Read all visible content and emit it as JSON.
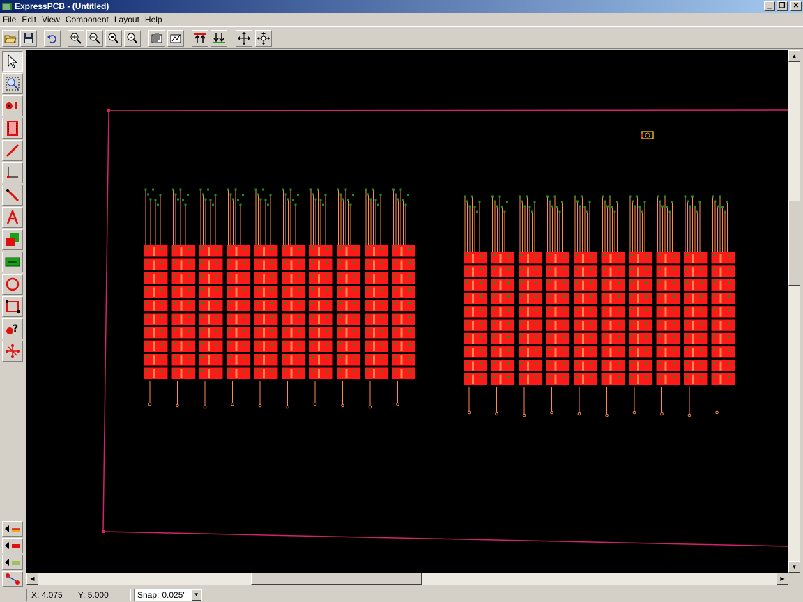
{
  "window": {
    "title": "ExpressPCB - (Untitled)"
  },
  "menu": [
    "File",
    "Edit",
    "View",
    "Component",
    "Layout",
    "Help"
  ],
  "toolbar": [
    {
      "name": "open-icon"
    },
    {
      "name": "save-icon"
    },
    {
      "name": "undo-icon"
    },
    {
      "name": "zoom-in-icon"
    },
    {
      "name": "zoom-out-icon"
    },
    {
      "name": "zoom-fit-icon"
    },
    {
      "name": "zoom-previous-icon"
    },
    {
      "name": "component-properties-icon"
    },
    {
      "name": "pad-properties-icon"
    },
    {
      "name": "top-layer-icon"
    },
    {
      "name": "bottom-layer-icon"
    },
    {
      "name": "move-icon"
    },
    {
      "name": "move-all-icon"
    }
  ],
  "left_tools": [
    {
      "name": "select-tool-icon"
    },
    {
      "name": "zoom-select-tool-icon"
    },
    {
      "name": "pad-tool-icon"
    },
    {
      "name": "component-tool-icon"
    },
    {
      "name": "trace-tool-icon"
    },
    {
      "name": "corner-trace-tool-icon"
    },
    {
      "name": "line-tool-icon"
    },
    {
      "name": "text-tool-icon"
    },
    {
      "name": "fill-tool-icon"
    },
    {
      "name": "ground-plane-tool-icon"
    },
    {
      "name": "circle-tool-icon"
    },
    {
      "name": "rectangle-tool-icon"
    },
    {
      "name": "query-tool-icon"
    },
    {
      "name": "netlist-tool-icon"
    }
  ],
  "layer_tools": [
    {
      "name": "top-layer-select-icon"
    },
    {
      "name": "bottom-layer-select-icon"
    },
    {
      "name": "silkscreen-layer-select-icon"
    },
    {
      "name": "ratsnest-tool-icon"
    }
  ],
  "colors": {
    "board_outline": "#d4226b",
    "pads": "#ff1a1a",
    "traces": "#ff8a4a",
    "vias": "#1a8f1a",
    "canvas": "#000000"
  },
  "status": {
    "x_label": "X: 4.075",
    "y_label": "Y: 5.000",
    "snap_label": "Snap:",
    "snap_value": "0.025\""
  }
}
